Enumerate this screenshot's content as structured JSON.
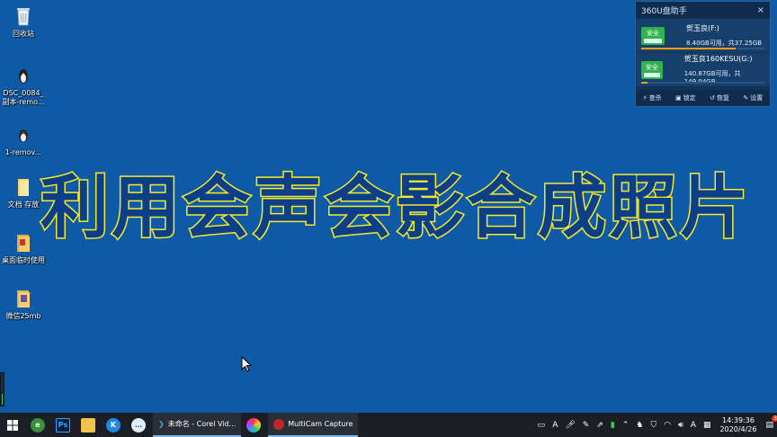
{
  "desktop": {
    "icons": [
      {
        "label": "回收站",
        "icon": "recycle-bin-icon"
      },
      {
        "label": "DSC_0084_副本-remo...",
        "icon": "penguin-image-icon"
      },
      {
        "label": "1-remov...",
        "icon": "penguin-image-icon"
      },
      {
        "label": "文档  存放",
        "icon": "folder-icon"
      },
      {
        "label": "桌面临时使用",
        "icon": "folder-icon"
      },
      {
        "label": "微信25mb",
        "icon": "folder-icon"
      }
    ]
  },
  "banner": {
    "text": "利用会声会影合成照片"
  },
  "u_panel": {
    "title": "360U盘助手",
    "close": "×",
    "drives": [
      {
        "badge": "安全",
        "name": "贺玉良(F:)",
        "size": "8.40GB可用，共37.25GB",
        "used_fraction": 0.77
      },
      {
        "badge": "安全",
        "name": "贺玉良160KESU(G:)",
        "size": "140.87GB可用，共149.04GB",
        "used_fraction": 0.05
      }
    ],
    "actions": [
      {
        "icon": "lightning-icon",
        "label": "查杀"
      },
      {
        "icon": "lock-icon",
        "label": "锁定"
      },
      {
        "icon": "restore-icon",
        "label": "恢复"
      },
      {
        "icon": "wrench-icon",
        "label": "设置"
      }
    ]
  },
  "taskbar": {
    "tasks": [
      {
        "label": "未命名 - Corel Vid..."
      },
      {
        "label": "MultiCam Capture"
      }
    ],
    "tray": {
      "ime": "A",
      "lang": "A",
      "time": "14:39:36",
      "date": "2020/4/26",
      "notif_count": "3"
    }
  },
  "colors": {
    "desktop": "#0f5aa6",
    "banner_stroke": "#f4ea2a",
    "taskbar": "#1b1f25"
  }
}
